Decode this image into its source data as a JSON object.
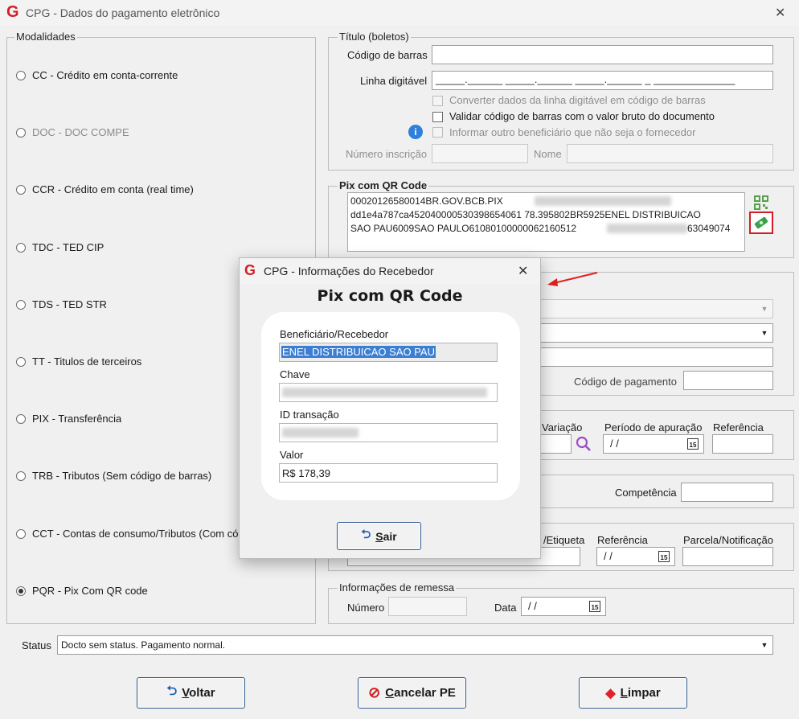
{
  "window": {
    "logo": "G",
    "title": "CPG - Dados do pagamento eletrônico",
    "close": "✕"
  },
  "modalidades": {
    "legend": "Modalidades",
    "items": [
      {
        "label": "CC  - Crédito em conta-corrente",
        "disabled": false,
        "checked": false
      },
      {
        "label": "DOC - DOC COMPE",
        "disabled": true,
        "checked": false
      },
      {
        "label": "CCR - Crédito em conta (real time)",
        "disabled": false,
        "checked": false
      },
      {
        "label": "TDC - TED CIP",
        "disabled": false,
        "checked": false
      },
      {
        "label": "TDS - TED STR",
        "disabled": false,
        "checked": false
      },
      {
        "label": "TT  - Titulos de terceiros",
        "disabled": false,
        "checked": false
      },
      {
        "label": "PIX - Transferência",
        "disabled": false,
        "checked": false
      },
      {
        "label": "TRB - Tributos (Sem código de barras)",
        "disabled": false,
        "checked": false
      },
      {
        "label": "CCT - Contas de consumo/Tributos (Com có",
        "disabled": false,
        "checked": false
      },
      {
        "label": "PQR - Pix Com QR code",
        "disabled": false,
        "checked": true
      }
    ]
  },
  "titulo": {
    "legend": "Título (boletos)",
    "codigo_barras_label": "Código de barras",
    "linha_digitavel_label": "Linha digitável",
    "linha_digitavel_mask": "_____.______ _____.______ _____.______ _ ______________",
    "chk_converter": "Converter dados da linha digitável em código de barras",
    "chk_validar": "Validar código de barras com o valor bruto do documento",
    "chk_informar": "Informar outro beneficiário que não seja o fornecedor",
    "info_icon": "i",
    "numero_inscricao_label": "Número inscrição",
    "nome_label": "Nome"
  },
  "pix_qr": {
    "legend": "Pix com QR Code",
    "line1": "00020126580014BR.GOV.BCB.PIX",
    "line2": "dd1e4a787ca452040000530398654061 78.395802BR5925ENEL DISTRIBUICAO",
    "line3_a": "SAO PAU6009SAO PAULO61080100000062160512",
    "line3_b": "63049074"
  },
  "hidden_section": {
    "codigo_pagamento_label": "Código de pagamento",
    "variacao_label": "Variação",
    "periodo_apuracao_label": "Período de apuração",
    "referencia_label": "Referência",
    "periodo_value": " / /",
    "competencia_label": "Competência",
    "etiqueta_label": "/Etiqueta",
    "referencia2_label": "Referência",
    "referencia2_value": " / /",
    "parcela_label": "Parcela/Notificação"
  },
  "remessa": {
    "legend": "Informações de remessa",
    "numero_label": "Número",
    "data_label": "Data",
    "data_value": " / /"
  },
  "status": {
    "label": "Status",
    "value": "Docto sem status. Pagamento normal."
  },
  "buttons": {
    "voltar": {
      "icon": "⮌",
      "first": "V",
      "rest": "oltar"
    },
    "cancelar": {
      "icon": "⊘",
      "first": "C",
      "rest": "ancelar PE"
    },
    "limpar": {
      "icon": "◆",
      "first": "L",
      "rest": "impar"
    }
  },
  "calendar_icon_text": "15",
  "dialog": {
    "logo": "G",
    "title": "CPG - Informações do Recebedor",
    "close": "✕",
    "heading": "Pix com QR Code",
    "beneficiario_label": "Beneficiário/Recebedor",
    "beneficiario_value": "ENEL DISTRIBUICAO SAO PAU",
    "chave_label": "Chave",
    "id_transacao_label": "ID transação",
    "valor_label": "Valor",
    "valor_value": "R$ 178,39",
    "sair": {
      "icon": "⮌",
      "first": "S",
      "rest": "air"
    }
  },
  "colors": {
    "accent_red": "#d01f24",
    "button_border": "#2f5b8e",
    "selection": "#3b7fd4"
  }
}
